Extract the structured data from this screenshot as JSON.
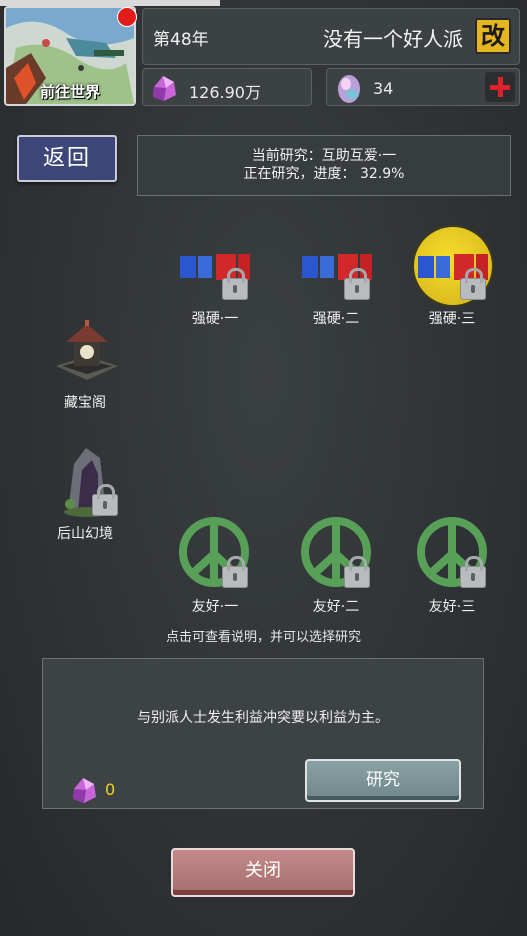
{
  "header": {
    "world_button_label": "前往世界",
    "year": "第48年",
    "sect_name": "没有一个好人派",
    "rename_label": "改",
    "money": "126.90万",
    "gems": "34"
  },
  "back_label": "返回",
  "research": {
    "current": "当前研究：互助互爱·一",
    "progress_line": "正在研究，进度： 32.9%"
  },
  "nodes": {
    "hard1": "强硬·一",
    "hard2": "强硬·二",
    "hard3": "强硬·三",
    "treasure": "藏宝阁",
    "mountain": "后山幻境",
    "friend1": "友好·一",
    "friend2": "友好·二",
    "friend3": "友好·三"
  },
  "hint": "点击可查看说明，并可以选择研究",
  "detail": {
    "description": "与别派人士发生利益冲突要以利益为主。",
    "cost": "0",
    "study_label": "研究"
  },
  "close_label": "关闭",
  "colors": {
    "background": "#2e3234",
    "accent_gold": "#e5b522",
    "peace_green": "#58a057",
    "close_button": "#b27b7b",
    "study_button": "#7d9498"
  }
}
